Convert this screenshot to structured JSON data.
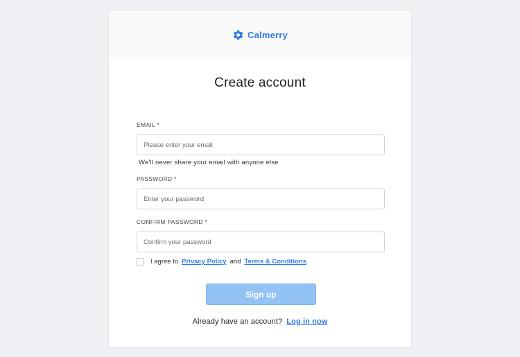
{
  "brand": {
    "name": "Calmerry",
    "icon": "gear-icon",
    "color": "#2f7be0"
  },
  "title": "Create account",
  "form": {
    "email": {
      "label": "EMAIL *",
      "placeholder": "Please enter your email",
      "value": "",
      "helper": "We'll never share your email with anyone else"
    },
    "password": {
      "label": "PASSWORD *",
      "placeholder": "Enter your password",
      "value": ""
    },
    "confirm_password": {
      "label": "CONFIRM PASSWORD *",
      "placeholder": "Confirm your password",
      "value": ""
    },
    "terms": {
      "checked": false,
      "prefix": "I agree to",
      "privacy_link": "Privacy Policy",
      "conjunction": "and",
      "terms_link": "Terms & Conditions"
    },
    "submit_label": "Sign up"
  },
  "login": {
    "prompt": "Already have an account?",
    "link": "Log in now"
  },
  "colors": {
    "page_bg": "#eef0f4",
    "accent": "#2f7be0",
    "button_bg": "#93c2f5"
  }
}
